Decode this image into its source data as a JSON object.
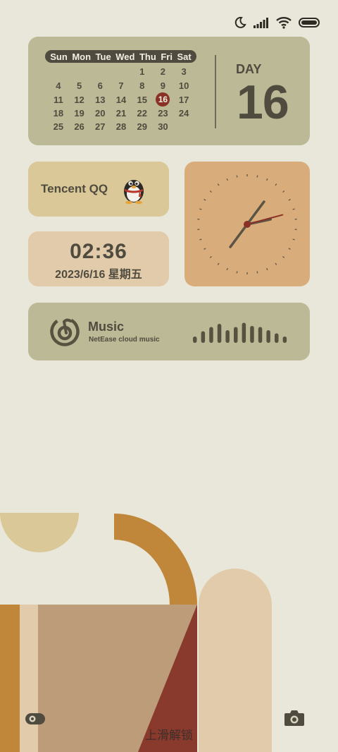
{
  "status_bar": {
    "icons": [
      "moon-icon",
      "signal-icon",
      "wifi-icon",
      "battery-icon"
    ]
  },
  "calendar": {
    "weekdays": [
      "Sun",
      "Mon",
      "Tue",
      "Wed",
      "Thu",
      "Fri",
      "Sat"
    ],
    "weeks": [
      [
        "",
        "",
        "",
        "",
        "1",
        "2",
        "3"
      ],
      [
        "4",
        "5",
        "6",
        "7",
        "8",
        "9",
        "10"
      ],
      [
        "11",
        "12",
        "13",
        "14",
        "15",
        "16",
        "17"
      ],
      [
        "18",
        "19",
        "20",
        "21",
        "22",
        "23",
        "24"
      ],
      [
        "25",
        "26",
        "27",
        "28",
        "29",
        "30",
        ""
      ]
    ],
    "today": "16",
    "day_label": "DAY",
    "day_number": "16"
  },
  "qq_widget": {
    "title": "Tencent QQ",
    "icon": "penguin-icon"
  },
  "analog_clock": {
    "hour": 2,
    "minute": 36,
    "second": 7
  },
  "time_widget": {
    "time": "02:36",
    "date": "2023/6/16 星期五"
  },
  "music_widget": {
    "title": "Music",
    "subtitle": "NetEase cloud music",
    "icon": "netease-music-icon",
    "wave_levels": [
      0.3,
      0.55,
      0.75,
      0.9,
      0.6,
      0.75,
      0.95,
      0.8,
      0.75,
      0.6,
      0.45,
      0.3
    ]
  },
  "lock_screen": {
    "unlock_hint": "上滑解锁",
    "left_shortcut": "flashlight-icon",
    "right_shortcut": "camera-icon"
  },
  "colors": {
    "background": "#e8e7d9",
    "olive": "#bcb996",
    "sand": "#dbc898",
    "peach": "#d8ad7b",
    "blush": "#e2cbab",
    "dark_text": "#4f4b3e",
    "accent_red": "#8a3127",
    "amber": "#c0873a"
  }
}
